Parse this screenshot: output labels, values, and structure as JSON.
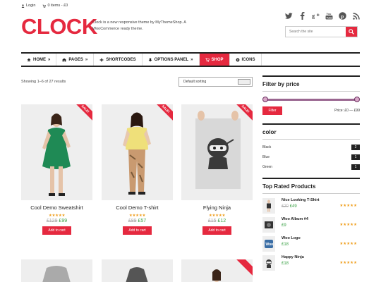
{
  "topbar": {
    "login": "Login",
    "items": "0 items - £0"
  },
  "logo": "CLOCK",
  "tagline": "Clock is a new responsive theme by MyThemeShop. A WooCommerce ready theme.",
  "social_icons": [
    "twitter-icon",
    "facebook-icon",
    "google-plus-icon",
    "youtube-icon",
    "pinterest-icon",
    "rss-icon"
  ],
  "search": {
    "placeholder": "Search the site"
  },
  "nav": [
    {
      "label": "HOME",
      "icon": "home-icon",
      "arrow": "»"
    },
    {
      "label": "PAGES",
      "icon": "pages-icon",
      "arrow": "»"
    },
    {
      "label": "SHORTCODES",
      "icon": "plus-icon",
      "arrow": ""
    },
    {
      "label": "OPTIONS PANEL",
      "icon": "options-icon",
      "arrow": "»"
    },
    {
      "label": "SHOP",
      "icon": "cart-icon",
      "arrow": ""
    },
    {
      "label": "ICONS",
      "icon": "icons-icon",
      "arrow": ""
    }
  ],
  "showing": "Showing 1–6 of 27 results",
  "sort": {
    "selected": "Default sorting"
  },
  "products": [
    {
      "name": "Cool Demo Sweatshirt",
      "sale": "SALE!",
      "old_price": "£129",
      "new_price": "£99",
      "rating": 5,
      "stars": "★★★★★",
      "cart": "Add to cart"
    },
    {
      "name": "Cool Demo T-shirt",
      "sale": "SALE!",
      "old_price": "£89",
      "new_price": "£57",
      "rating": 5,
      "stars": "★★★★★",
      "cart": "Add to cart"
    },
    {
      "name": "Flying Ninja",
      "sale": "SALE!",
      "old_price": "£15",
      "new_price": "£12",
      "rating": 5,
      "stars": "★★★★★",
      "cart": "Add to cart"
    }
  ],
  "sidebar": {
    "filter_title": "Filter by price",
    "filter_button": "Filter",
    "price_range": "Price: £0 — £99",
    "color_title": "color",
    "colors": [
      {
        "name": "Black",
        "count": "2"
      },
      {
        "name": "Blue",
        "count": "1"
      },
      {
        "name": "Green",
        "count": "1"
      }
    ],
    "top_title": "Top Rated Products",
    "top_products": [
      {
        "name": "Nice Looking T-Shirt",
        "old_price": "£20",
        "new_price": "£49",
        "stars": "★★★★★"
      },
      {
        "name": "Woo Album #4",
        "old_price": "",
        "new_price": "£9",
        "stars": "★★★★★"
      },
      {
        "name": "Woo Logo",
        "old_price": "",
        "new_price": "£18",
        "stars": "★★★★★"
      },
      {
        "name": "Happy Ninja",
        "old_price": "",
        "new_price": "£18",
        "stars": "★★★★★"
      }
    ]
  },
  "colors": {
    "accent": "#e5293f",
    "price_green": "#3aa045",
    "star": "#f0a020"
  }
}
